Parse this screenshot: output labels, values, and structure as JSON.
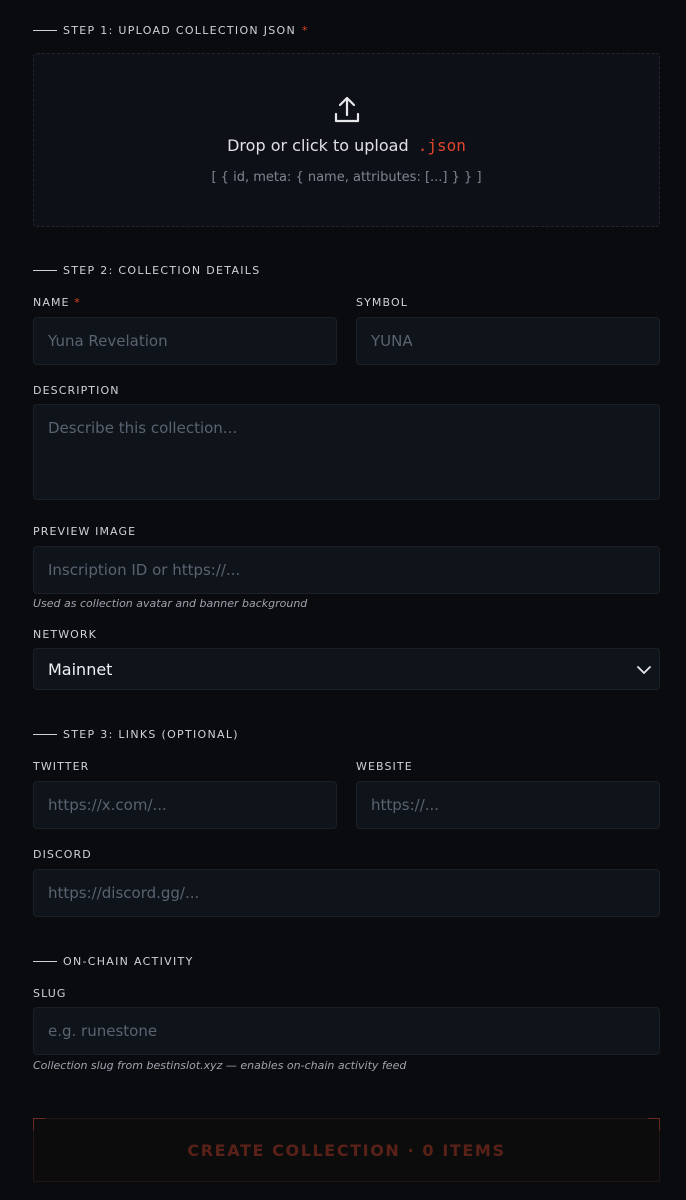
{
  "step1": {
    "heading": "STEP 1: UPLOAD COLLECTION JSON",
    "required_mark": "*",
    "upload": {
      "icon": "upload-icon",
      "title": "Drop or click to upload",
      "extension": ".json",
      "format_hint": "[ { id, meta: { name, attributes: [...] } } ]"
    }
  },
  "step2": {
    "heading": "STEP 2: COLLECTION DETAILS",
    "name": {
      "label": "NAME",
      "required_mark": "*",
      "placeholder": "Yuna Revelation"
    },
    "symbol": {
      "label": "SYMBOL",
      "placeholder": "YUNA"
    },
    "description": {
      "label": "DESCRIPTION",
      "placeholder": "Describe this collection..."
    },
    "preview": {
      "label": "PREVIEW IMAGE",
      "placeholder": "Inscription ID or https://...",
      "hint": "Used as collection avatar and banner background"
    },
    "network": {
      "label": "NETWORK",
      "selected": "Mainnet",
      "icon": "chevron-down-icon"
    }
  },
  "step3": {
    "heading": "STEP 3: LINKS (OPTIONAL)",
    "twitter": {
      "label": "TWITTER",
      "placeholder": "https://x.com/..."
    },
    "website": {
      "label": "WEBSITE",
      "placeholder": "https://..."
    },
    "discord": {
      "label": "DISCORD",
      "placeholder": "https://discord.gg/..."
    }
  },
  "onchain": {
    "heading": "ON-CHAIN ACTIVITY",
    "slug": {
      "label": "SLUG",
      "placeholder": "e.g. runestone",
      "hint": "Collection slug from bestinslot.xyz — enables on-chain activity feed"
    }
  },
  "create_button": {
    "label": "CREATE COLLECTION · 0 ITEMS"
  },
  "colors": {
    "accent": "#e0452b",
    "background": "#0a0b0e",
    "field": "#0f131a"
  }
}
